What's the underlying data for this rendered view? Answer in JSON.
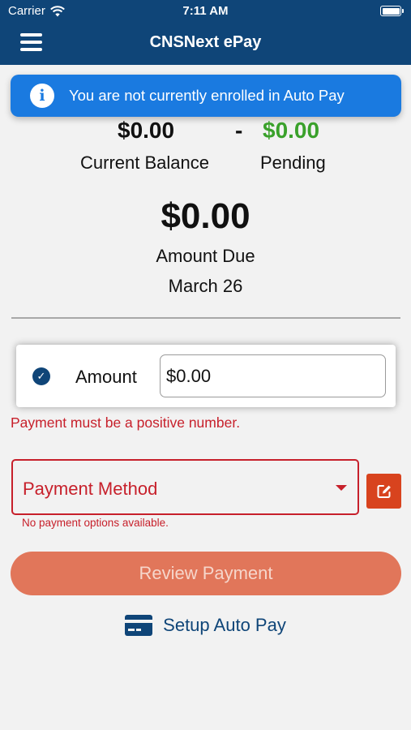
{
  "status_bar": {
    "carrier": "Carrier",
    "time": "7:11 AM"
  },
  "header": {
    "title": "CNSNext ePay"
  },
  "banner": {
    "message": "You are not currently enrolled in Auto Pay"
  },
  "balance": {
    "current_value": "$0.00",
    "current_label": "Current Balance",
    "separator": "-",
    "pending_value": "$0.00",
    "pending_label": "Pending"
  },
  "amount_due": {
    "value": "$0.00",
    "label": "Amount Due",
    "date": "March 26"
  },
  "amount_field": {
    "label": "Amount",
    "value": "$0.00"
  },
  "amount_error": "Payment must be a positive number.",
  "payment_method": {
    "label": "Payment Method",
    "error": "No payment options available."
  },
  "review_button": "Review Payment",
  "autopay_link": "Setup Auto Pay",
  "colors": {
    "header_bg": "#0f4578",
    "banner_bg": "#1a7ae0",
    "pending_green": "#3aa12b",
    "error_red": "#c7202b",
    "review_btn_bg": "#e1765a",
    "edit_btn_bg": "#d8431e"
  }
}
